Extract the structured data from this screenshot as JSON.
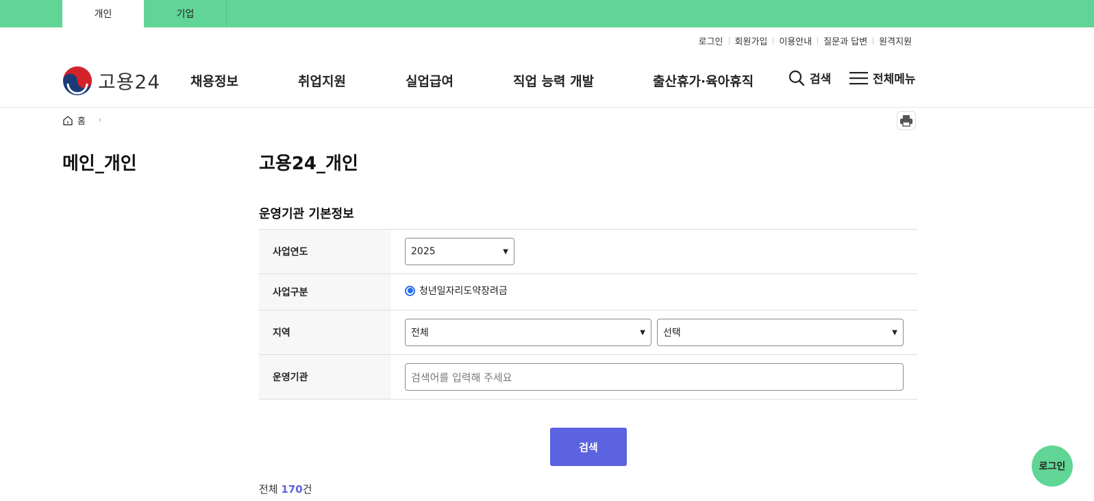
{
  "top_tabs": [
    {
      "label": "개인",
      "active": true
    },
    {
      "label": "기업",
      "active": false
    }
  ],
  "util_links": [
    "로그인",
    "회원가입",
    "이용안내",
    "질문과 답변",
    "원격지원"
  ],
  "logo": {
    "text": "고용24"
  },
  "gnb": [
    "채용정보",
    "취업지원",
    "실업급여",
    "직업 능력 개발",
    "출산휴가·육아휴직"
  ],
  "header_actions": {
    "search_label": "검색",
    "menu_label": "전체메뉴"
  },
  "breadcrumb": {
    "home_label": "홈"
  },
  "side_title": "메인_개인",
  "page_title": "고용24_개인",
  "section_title": "운영기관 기본정보",
  "form": {
    "year": {
      "label": "사업연도",
      "value": "2025"
    },
    "biz_type": {
      "label": "사업구분",
      "option": "청년일자리도약장려금",
      "checked": true
    },
    "region": {
      "label": "지역",
      "value1": "전체",
      "value2": "선택"
    },
    "org": {
      "label": "운영기관",
      "placeholder": "검색어를 입력해 주세요"
    }
  },
  "search_button": "검색",
  "total": {
    "prefix": "전체 ",
    "count": "170",
    "suffix": "건"
  },
  "float_login": "로그인",
  "colors": {
    "brand_green": "#61d595",
    "accent": "#5b63e0",
    "radio": "#2a6cf0"
  }
}
